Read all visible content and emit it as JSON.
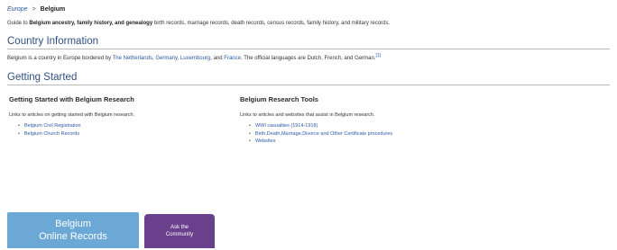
{
  "breadcrumb": {
    "parent": "Europe",
    "separator": ">",
    "current": "Belgium"
  },
  "intro": {
    "prefix": "Guide to ",
    "bold": "Belgium ancestry, family history, and genealogy",
    "rest": " birth records, marriage records, death records, census records, family history, and military records."
  },
  "country": {
    "heading": "Country Information",
    "text_prefix": "Belgium is a country in Europe bordered by ",
    "links": [
      "The Netherlands",
      "Germany",
      "Luxembourg"
    ],
    "text_and": ", and ",
    "last_link": "France",
    "text_suffix": ". The official languages are Dutch, French, and German.",
    "footnote": "[1]"
  },
  "started": {
    "heading": "Getting Started",
    "col1": {
      "title": "Getting Started with Belgium Research",
      "desc": "Links to articles on getting started with Belgium research.",
      "items": [
        "Belgium Civil Registration",
        "Belgium Church Records"
      ]
    },
    "col2": {
      "title": "Belgium Research Tools",
      "desc": "Links to articles and websites that assist in Belgium research.",
      "items": [
        "WWI casualties (1914-1918)",
        "Birth,Death,Marriage,Divorce and Other Certificate procedures",
        "Websites"
      ]
    }
  },
  "buttons": {
    "records": {
      "line1": "Belgium",
      "line2": "Online Records"
    },
    "community": {
      "line1": "Ask the",
      "line2": "Community"
    }
  },
  "colors": {
    "link": "#2b59a8",
    "heading": "#2f4f83",
    "records_button": "#6ba8d6",
    "community_button": "#6a3f8c"
  }
}
